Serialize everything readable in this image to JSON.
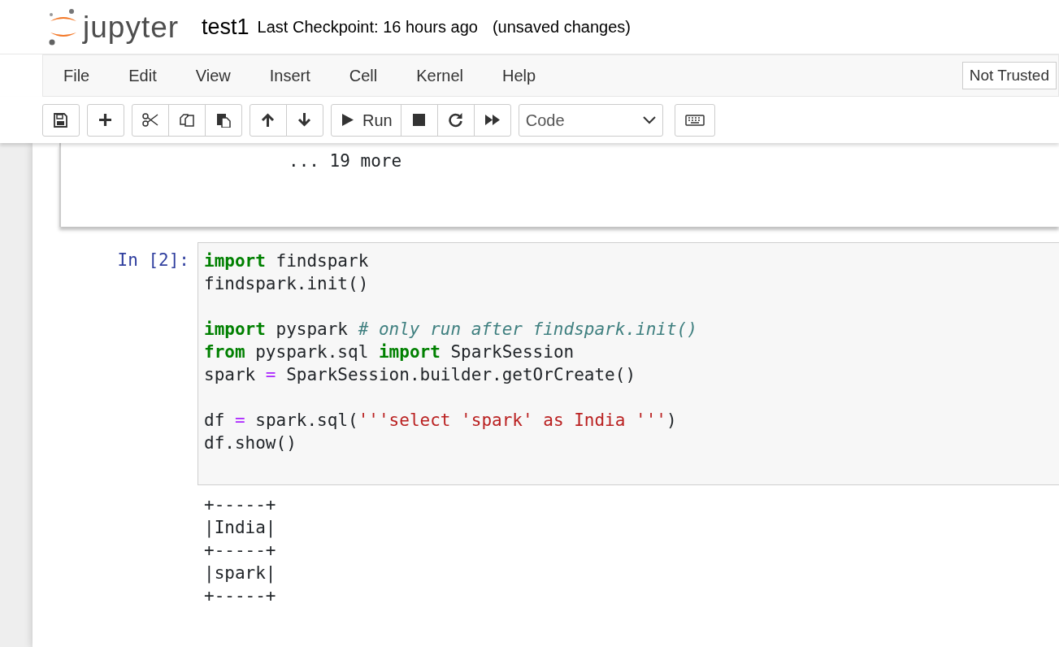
{
  "header": {
    "logo_text": "jupyter",
    "notebook_name": "test1",
    "checkpoint": "Last Checkpoint: 16 hours ago",
    "save_status": "(unsaved changes)"
  },
  "menu": [
    "File",
    "Edit",
    "View",
    "Insert",
    "Cell",
    "Kernel",
    "Help"
  ],
  "trust_indicator": "Not Trusted",
  "toolbar": {
    "groups": [
      [
        {
          "kind": "save"
        }
      ],
      [
        {
          "kind": "plus"
        }
      ],
      [
        {
          "kind": "cut"
        },
        {
          "kind": "copy"
        },
        {
          "kind": "paste"
        }
      ],
      [
        {
          "kind": "up"
        },
        {
          "kind": "down"
        }
      ],
      [
        {
          "kind": "run",
          "label": "Run"
        },
        {
          "kind": "stop"
        },
        {
          "kind": "restart"
        },
        {
          "kind": "fastforward"
        }
      ]
    ],
    "cell_type": "Code"
  },
  "cells": [
    {
      "kind": "output",
      "lines": [
        "... 19 more"
      ]
    },
    {
      "kind": "code",
      "prompt": "In [2]:",
      "lines": [
        {
          "tokens": [
            {
              "kind": "keyword",
              "text": "import"
            },
            {
              "kind": "name",
              "text": " findspark"
            }
          ]
        },
        {
          "tokens": [
            {
              "kind": "name",
              "text": "findspark.init()"
            }
          ],
          "gap_after": true
        },
        {
          "tokens": [
            {
              "kind": "keyword",
              "text": "import"
            },
            {
              "kind": "name",
              "text": " pyspark "
            },
            {
              "kind": "comment",
              "text": "# only run after findspark.init()"
            }
          ]
        },
        {
          "tokens": [
            {
              "kind": "keyword",
              "text": "from"
            },
            {
              "kind": "name",
              "text": " pyspark.sql "
            },
            {
              "kind": "keyword",
              "text": "import"
            },
            {
              "kind": "name",
              "text": " SparkSession"
            }
          ]
        },
        {
          "tokens": [
            {
              "kind": "name",
              "text": "spark "
            },
            {
              "kind": "operator",
              "text": "="
            },
            {
              "kind": "name",
              "text": " SparkSession.builder.getOrCreate()"
            }
          ],
          "gap_after": true
        },
        {
          "tokens": [
            {
              "kind": "name",
              "text": "df "
            },
            {
              "kind": "operator",
              "text": "="
            },
            {
              "kind": "name",
              "text": " spark.sql("
            },
            {
              "kind": "string",
              "text": "'''select 'spark' as India '''"
            },
            {
              "kind": "name",
              "text": ")"
            }
          ]
        },
        {
          "tokens": [
            {
              "kind": "name",
              "text": "df.show()"
            }
          ]
        }
      ],
      "output": [
        "+-----+",
        "|India|",
        "+-----+",
        "|spark|",
        "+-----+"
      ]
    }
  ]
}
